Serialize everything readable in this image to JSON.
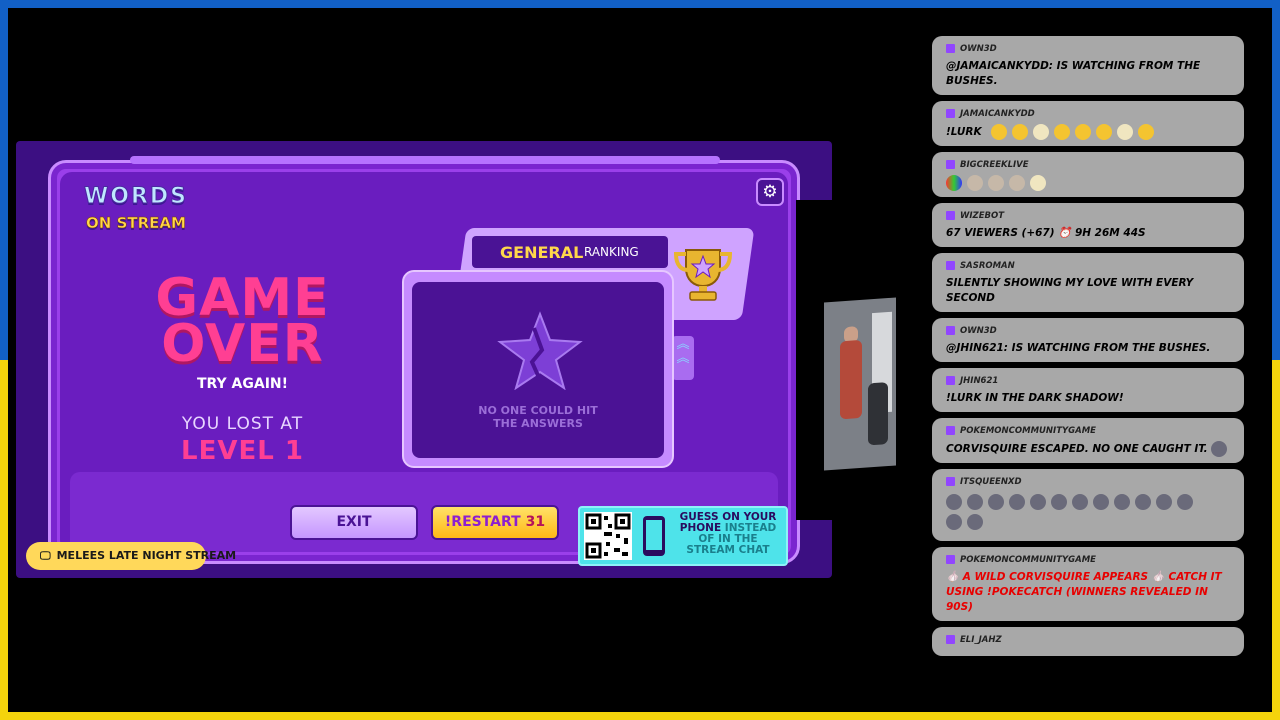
{
  "game": {
    "logo_line1": "WORDS",
    "logo_line2": "ON STREAM",
    "settings_icon": "gear-icon",
    "title_line1": "GAME",
    "title_line2": "OVER",
    "try_again": "TRY AGAIN!",
    "lost_at": "YOU LOST AT",
    "level": "LEVEL 1",
    "ranking_general": "GENERAL",
    "ranking_label": "RANKING",
    "no_answers_line1": "NO ONE COULD HIT",
    "no_answers_line2": "THE ANSWERS",
    "exit_label": "EXIT",
    "restart_prefix": "!RESTART",
    "restart_count": "31",
    "qr_line1": "GUESS ON YOUR",
    "qr_line2a": "PHONE",
    "qr_line2b": "INSTEAD",
    "qr_line3": "OF IN THE",
    "qr_line4": "STREAM CHAT",
    "stream_badge": "MELEES LATE NIGHT STREAM",
    "colors": {
      "accent_pink": "#ff3f93",
      "accent_yellow": "#ffd84a",
      "panel_purple": "#6a1dbf"
    }
  },
  "chat": {
    "messages": [
      {
        "user": "OWN3D",
        "text": "@JAMAICANKYDD: IS WATCHING FROM THE BUSHES."
      },
      {
        "user": "JAMAICANKYDD",
        "text": "!LURK"
      },
      {
        "user": "BIGCREEKLIVE",
        "text": ""
      },
      {
        "user": "WIZEBOT",
        "text": "67 VIEWERS (+67)",
        "text2": "9H 26M 44S"
      },
      {
        "user": "SASROMAN",
        "text": "SILENTLY SHOWING MY LOVE WITH EVERY SECOND"
      },
      {
        "user": "OWN3D",
        "text": "@JHIN621: IS WATCHING FROM THE BUSHES."
      },
      {
        "user": "JHIN621",
        "text": "!LURK IN THE DARK SHADOW!"
      },
      {
        "user": "POKEMONCOMMUNITYGAME",
        "text": "CORVISQUIRE ESCAPED. NO ONE CAUGHT IT."
      },
      {
        "user": "ITSQUEENXD",
        "text": ""
      },
      {
        "user": "POKEMONCOMMUNITYGAME",
        "text": "A WILD CORVISQUIRE APPEARS",
        "text2": "CATCH IT USING !POKECATCH (WINNERS REVEALED IN 90S)"
      },
      {
        "user": "ELI_JAHZ",
        "text": ""
      }
    ]
  }
}
